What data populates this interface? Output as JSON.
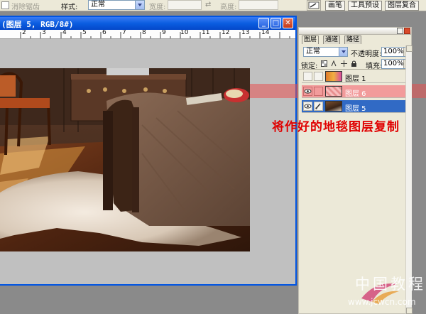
{
  "options_bar": {
    "antialias_label": "消除锯齿",
    "style_label": "样式:",
    "style_value": "正常",
    "width_label": "宽度:",
    "height_label": "高度:"
  },
  "tab_well": {
    "tabs": [
      "画笔",
      "工具预设",
      "图层复合"
    ]
  },
  "document": {
    "title": "(图层 5, RGB/8#)",
    "ruler_labels": [
      "2",
      "3",
      "4",
      "5",
      "6",
      "7",
      "8",
      "9",
      "10",
      "11",
      "12",
      "13",
      "14"
    ]
  },
  "layers_panel": {
    "tabs": [
      "图层",
      "通道",
      "路径"
    ],
    "blend_mode": "正常",
    "opacity_label": "不透明度:",
    "opacity_value": "100%",
    "lock_label": "锁定:",
    "fill_label": "填充:",
    "fill_value": "100%",
    "layers": [
      {
        "name": "图层 1",
        "visible": false,
        "state": "normal"
      },
      {
        "name": "图层 6",
        "visible": true,
        "state": "highlighted"
      },
      {
        "name": "图层 5",
        "visible": true,
        "state": "selected"
      }
    ]
  },
  "annotation": "将作好的地毯图层复制",
  "watermark": {
    "text": "中国教程网",
    "url": "www.jcwcn.com"
  },
  "colors": {
    "selected_row": "#316ac5",
    "highlight_row": "#f29b9b",
    "annotation": "#e00000",
    "titlebar": "#0a5de0"
  }
}
